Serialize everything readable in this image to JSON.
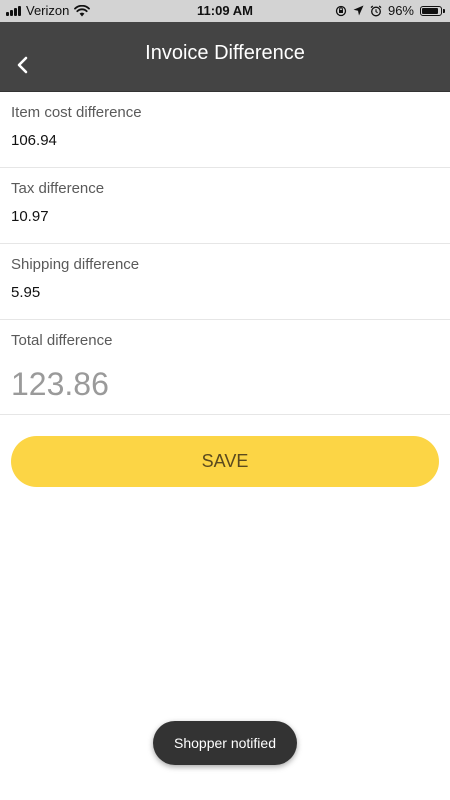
{
  "status_bar": {
    "carrier": "Verizon",
    "time": "11:09 AM",
    "battery_percent": "96%",
    "battery_level": 0.96,
    "icons": [
      "signal-icon",
      "wifi-icon",
      "orientation-lock-icon",
      "location-icon",
      "alarm-icon",
      "battery-icon"
    ]
  },
  "nav": {
    "title": "Invoice Difference",
    "back_icon": "chevron-left-icon"
  },
  "fields": {
    "item_cost": {
      "label": "Item cost difference",
      "value": "106.94"
    },
    "tax": {
      "label": "Tax difference",
      "value": "10.97"
    },
    "shipping": {
      "label": "Shipping difference",
      "value": "5.95"
    },
    "total": {
      "label": "Total difference",
      "value": "123.86"
    }
  },
  "actions": {
    "save_label": "SAVE"
  },
  "toast": {
    "message": "Shopper notified"
  },
  "colors": {
    "nav_background": "#444444",
    "status_background": "#d3d3d3",
    "save_button": "#fcd545",
    "toast_background": "#333333"
  }
}
